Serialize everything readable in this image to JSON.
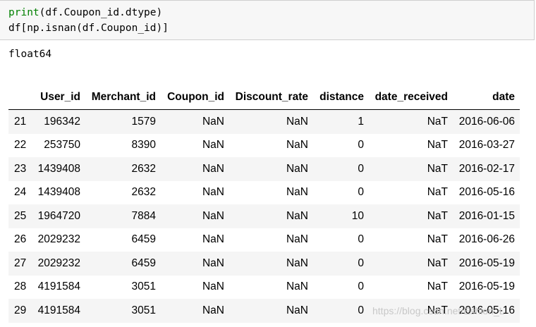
{
  "code": {
    "line1_fn": "print",
    "line1_rest": "(df.Coupon_id.dtype)",
    "line2": "df[np.isnan(df.Coupon_id)]"
  },
  "output_text": "float64",
  "table": {
    "columns": [
      "",
      "User_id",
      "Merchant_id",
      "Coupon_id",
      "Discount_rate",
      "distance",
      "date_received",
      "date"
    ],
    "rows": [
      [
        "21",
        "196342",
        "1579",
        "NaN",
        "NaN",
        "1",
        "NaT",
        "2016-06-06"
      ],
      [
        "22",
        "253750",
        "8390",
        "NaN",
        "NaN",
        "0",
        "NaT",
        "2016-03-27"
      ],
      [
        "23",
        "1439408",
        "2632",
        "NaN",
        "NaN",
        "0",
        "NaT",
        "2016-02-17"
      ],
      [
        "24",
        "1439408",
        "2632",
        "NaN",
        "NaN",
        "0",
        "NaT",
        "2016-05-16"
      ],
      [
        "25",
        "1964720",
        "7884",
        "NaN",
        "NaN",
        "10",
        "NaT",
        "2016-01-15"
      ],
      [
        "26",
        "2029232",
        "6459",
        "NaN",
        "NaN",
        "0",
        "NaT",
        "2016-06-26"
      ],
      [
        "27",
        "2029232",
        "6459",
        "NaN",
        "NaN",
        "0",
        "NaT",
        "2016-05-19"
      ],
      [
        "28",
        "4191584",
        "3051",
        "NaN",
        "NaN",
        "0",
        "NaT",
        "2016-05-19"
      ],
      [
        "29",
        "4191584",
        "3051",
        "NaN",
        "NaN",
        "0",
        "NaT",
        "2016-05-16"
      ]
    ]
  },
  "watermark": "https://blog.csdn.net/Eshion_L",
  "colors": {
    "keyword": "#008000",
    "code_bg": "#f7f7f7",
    "stripe": "#f5f5f5"
  }
}
